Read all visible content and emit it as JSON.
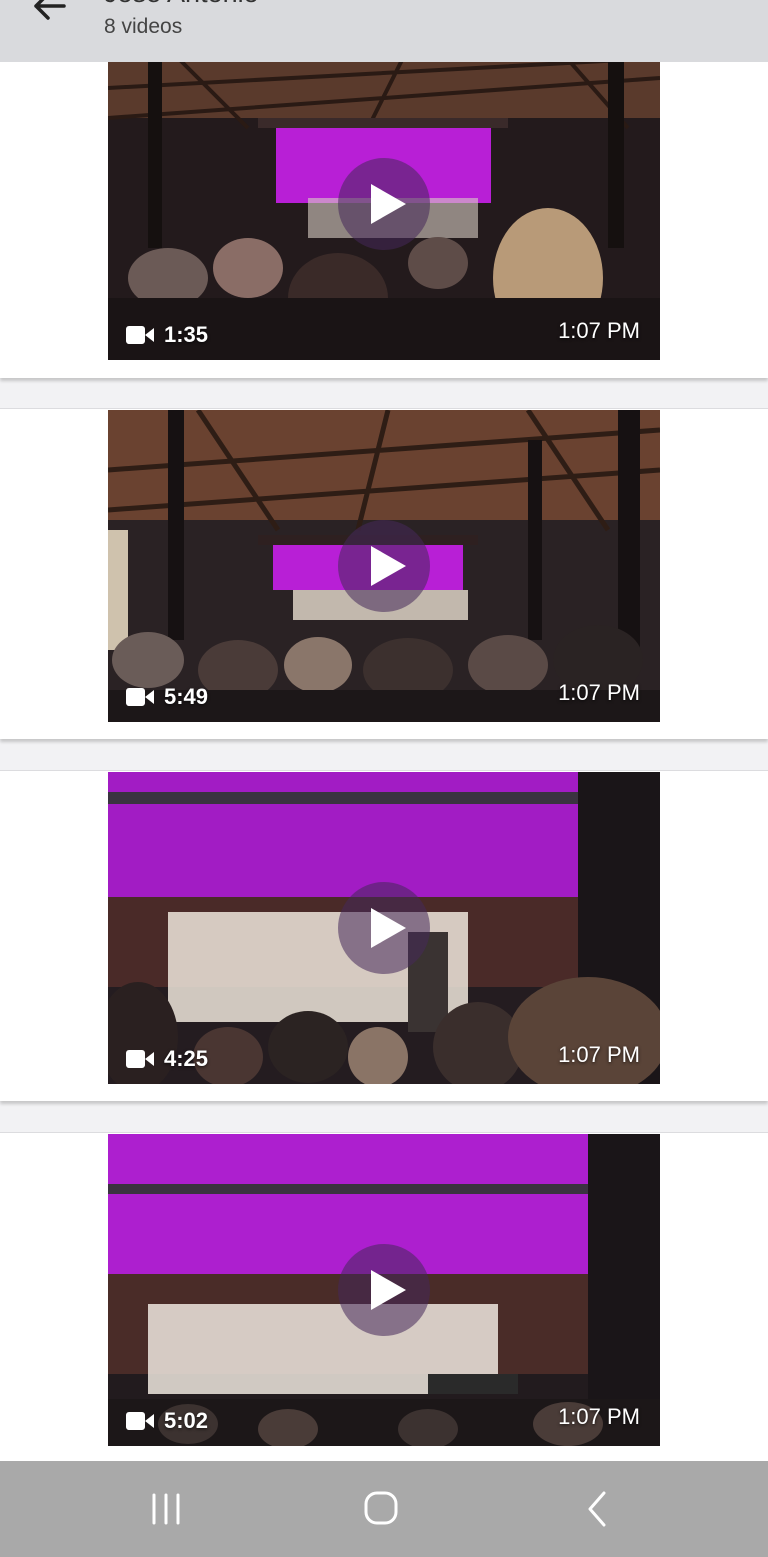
{
  "header": {
    "title": "José Antonio",
    "subtitle": "8 videos",
    "back_icon": "arrow-left-icon"
  },
  "videos": [
    {
      "duration": "1:35",
      "time": "1:07 PM"
    },
    {
      "duration": "5:49",
      "time": "1:07 PM"
    },
    {
      "duration": "4:25",
      "time": "1:07 PM"
    },
    {
      "duration": "5:02",
      "time": "1:07 PM"
    }
  ],
  "navbar": {
    "recents_icon": "recents-icon",
    "home_icon": "home-icon",
    "back_icon": "back-chevron-icon"
  },
  "colors": {
    "header_bg": "#d9dadd",
    "page_bg": "#f2f2f4",
    "navbar_bg": "#a9a9a9",
    "stage_purple": "#b81fd6"
  }
}
